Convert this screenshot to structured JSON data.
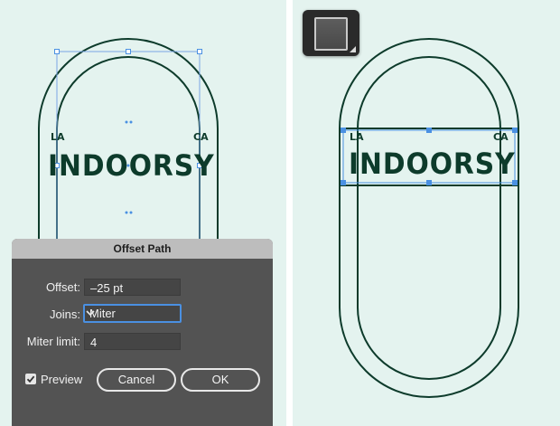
{
  "artwork": {
    "brand_text": "INDOORSY",
    "left_corner": "LA",
    "right_corner": "CA"
  },
  "swatch_tool": {
    "icon": "fill-stroke-swatch-icon"
  },
  "dialog": {
    "title": "Offset Path",
    "offset_label": "Offset:",
    "offset_value": "–25 pt",
    "joins_label": "Joins:",
    "joins_value": "Miter",
    "miter_label": "Miter limit:",
    "miter_value": "4",
    "preview_label": "Preview",
    "preview_checked": true,
    "cancel_label": "Cancel",
    "ok_label": "OK"
  },
  "colors": {
    "canvas_bg": "#e4f3ef",
    "art_stroke": "#0d3b2b",
    "selection": "#4a90e2",
    "dialog_bg": "#535353"
  }
}
